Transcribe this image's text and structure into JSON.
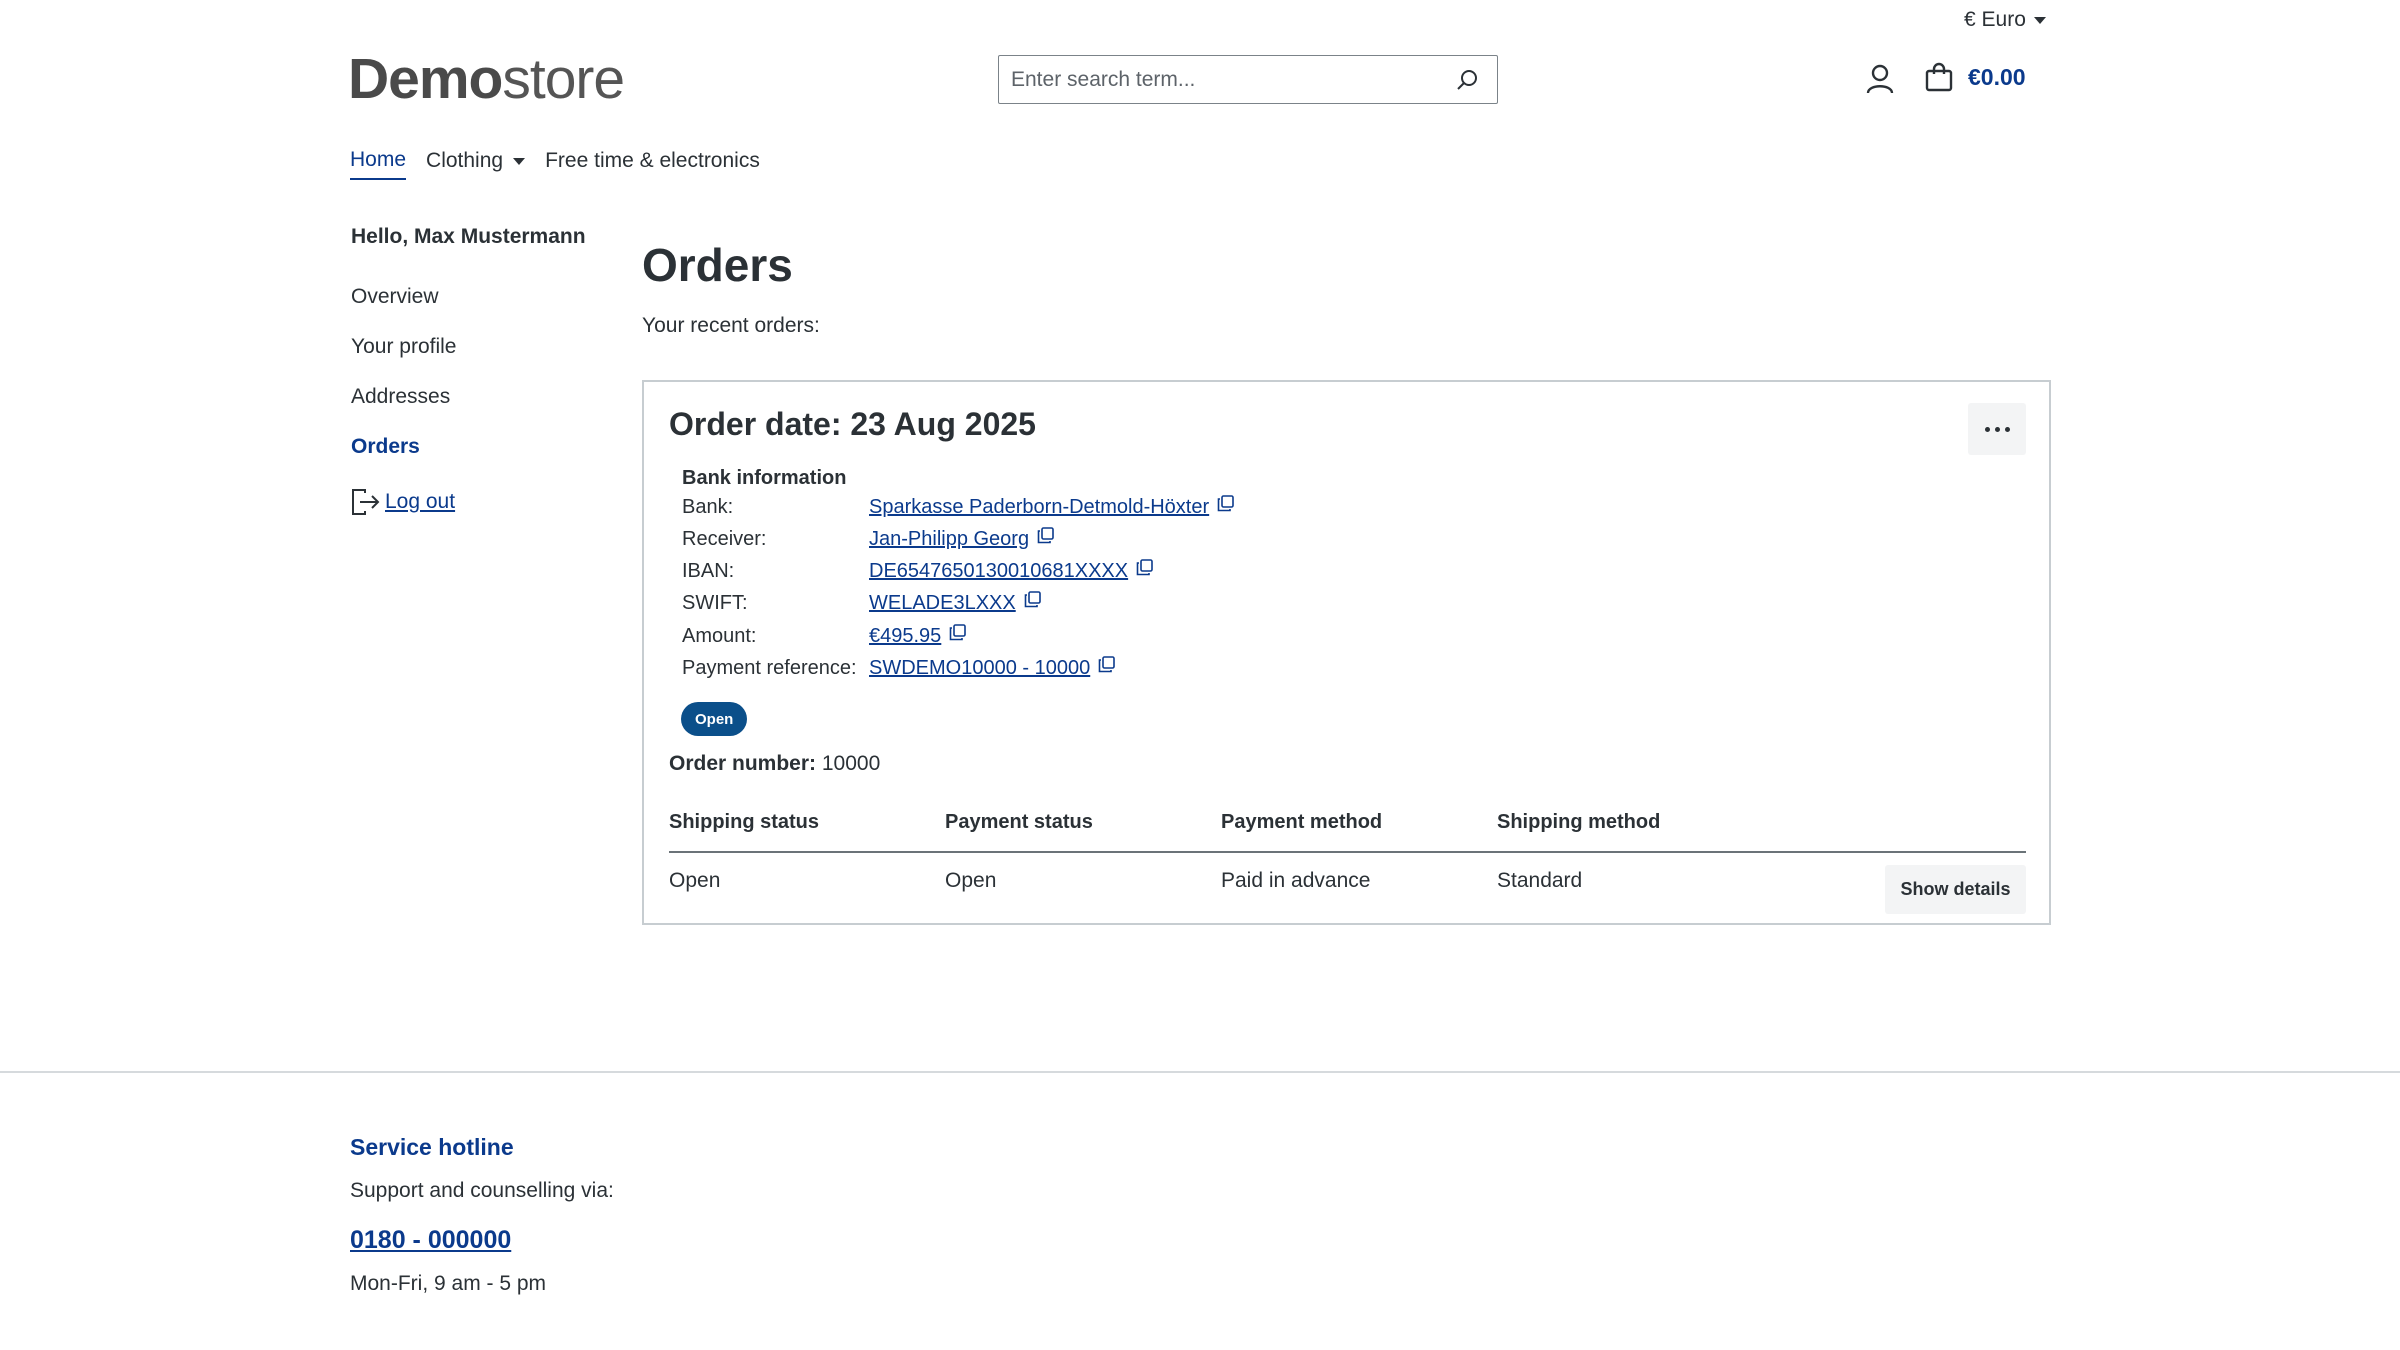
{
  "header": {
    "currency_label": "€ Euro",
    "logo_bold": "Demo",
    "logo_light": "store",
    "search_placeholder": "Enter search term...",
    "cart_amount": "€0.00"
  },
  "nav": {
    "items": [
      {
        "label": "Home",
        "active": true
      },
      {
        "label": "Clothing",
        "dropdown": true
      },
      {
        "label": "Free time & electronics"
      }
    ]
  },
  "sidebar": {
    "greeting": "Hello, Max Mustermann",
    "links": [
      {
        "label": "Overview"
      },
      {
        "label": "Your profile"
      },
      {
        "label": "Addresses"
      },
      {
        "label": "Orders",
        "active": true
      }
    ],
    "logout_label": " Log out"
  },
  "main": {
    "title": "Orders",
    "subtitle": "Your recent orders:",
    "order": {
      "date_label": "Order date: 23 Aug 2025",
      "bank_title": "Bank information",
      "bank_rows": [
        {
          "label": "Bank:",
          "value": "Sparkasse Paderborn-Detmold-Höxter"
        },
        {
          "label": "Receiver:",
          "value": "Jan-Philipp Georg"
        },
        {
          "label": "IBAN:",
          "value": "DE6547650130010681XXXX"
        },
        {
          "label": "SWIFT:",
          "value": "WELADE3LXXX"
        },
        {
          "label": "Amount:",
          "value": "€495.95"
        },
        {
          "label": "Payment reference:",
          "value": "SWDEMO10000 - 10000"
        }
      ],
      "status_badge": "Open",
      "order_number_label": "Order number:",
      "order_number": " 10000",
      "table": {
        "headers": [
          "Shipping status",
          "Payment status",
          "Payment method",
          "Shipping method"
        ],
        "values": [
          "Open",
          "Open",
          "Paid in advance",
          "Standard"
        ]
      },
      "details_button": "Show details"
    }
  },
  "footer": {
    "hotline_title": "Service hotline",
    "hotline_sub": "Support and counselling via:",
    "phone": "0180 - 000000",
    "hours": "Mon-Fri, 9 am - 5 pm"
  },
  "colors": {
    "accent": "#0b3a8c",
    "badge": "#0b4f8a",
    "text": "#2b3136"
  },
  "icons": [
    "caret-down-icon",
    "search-icon",
    "account-icon",
    "cart-icon",
    "logout-icon",
    "copy-icon",
    "more-options-icon"
  ]
}
